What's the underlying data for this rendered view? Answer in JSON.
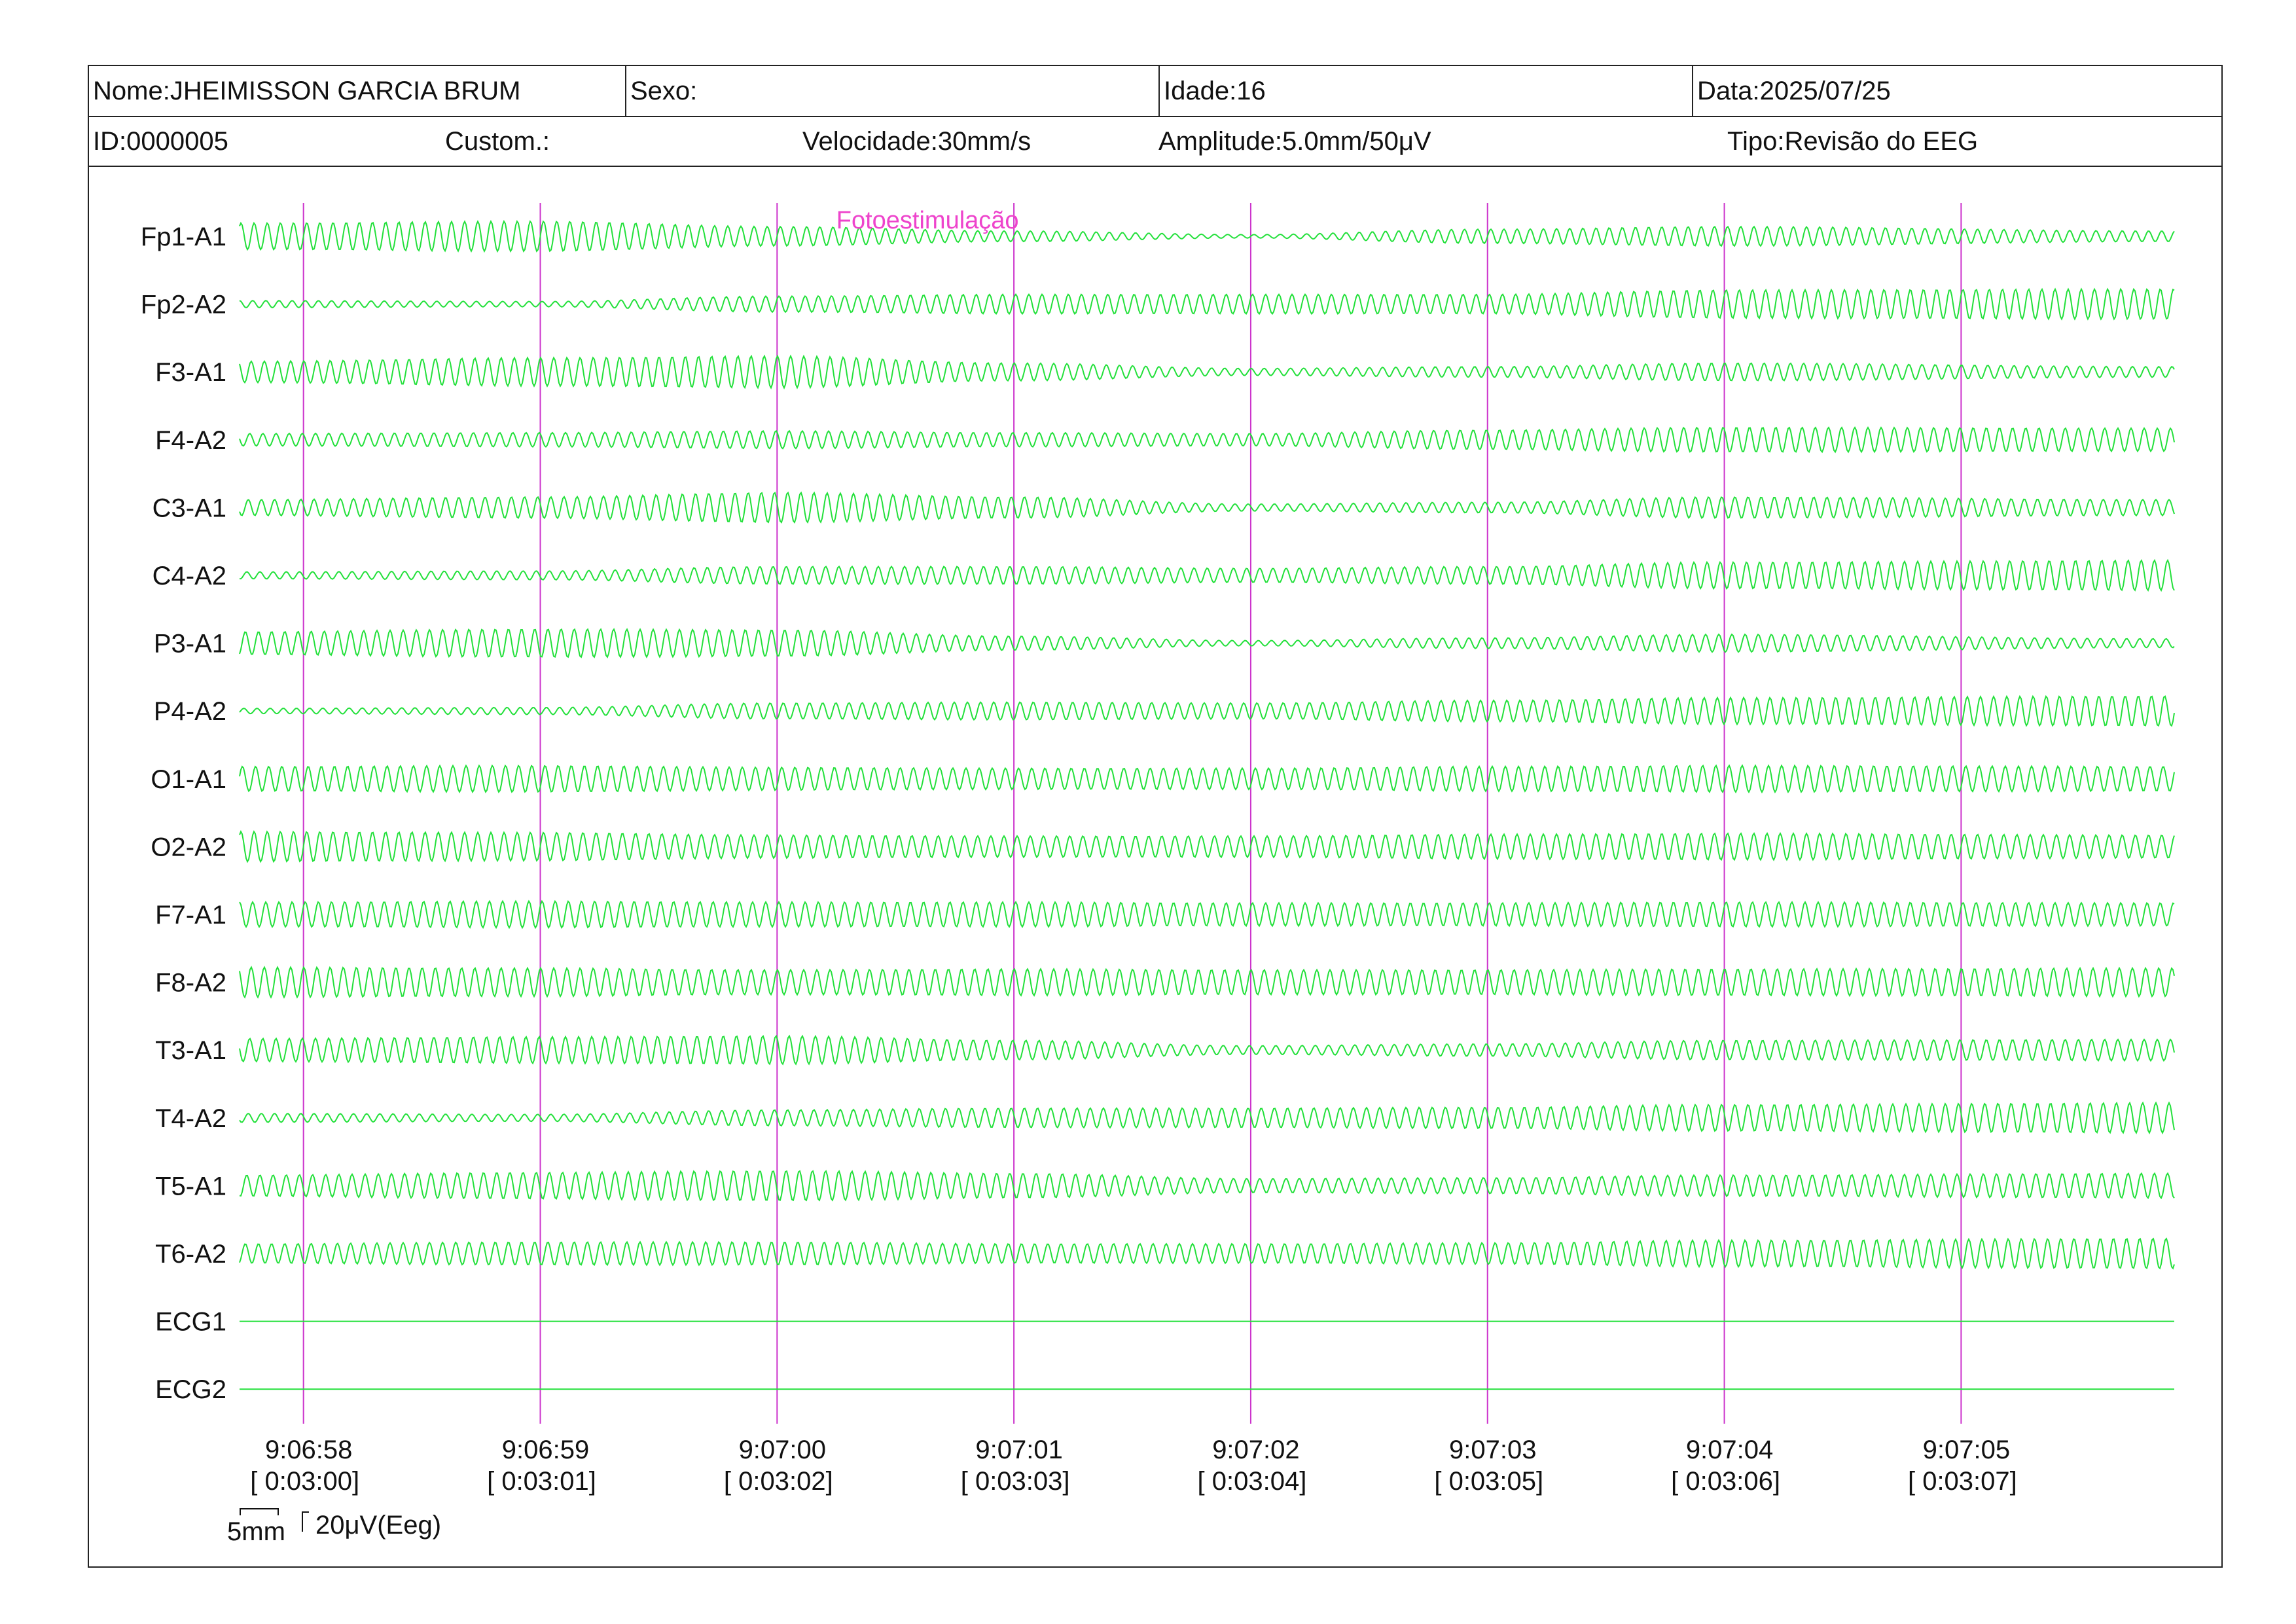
{
  "header": {
    "nome": "Nome:JHEIMISSON GARCIA BRUM",
    "sexo": "Sexo:",
    "idade": "Idade:16",
    "data": "Data:2025/07/25",
    "id": "ID:0000005",
    "custom": "Custom.:",
    "velocidade": "Velocidade:30mm/s",
    "amplitude": "Amplitude:5.0mm/50μV",
    "tipo": "Tipo:Revisão do EEG"
  },
  "colors": {
    "trace": "#22e03a",
    "marker": "#cc33cc",
    "annotation": "#ee44cc",
    "text": "#111111",
    "border": "#222222"
  },
  "chart_data": {
    "type": "line",
    "channels": [
      "Fp1-A1",
      "Fp2-A2",
      "F3-A1",
      "F4-A2",
      "C3-A1",
      "C4-A2",
      "P3-A1",
      "P4-A2",
      "O1-A1",
      "O2-A2",
      "F7-A1",
      "F8-A2",
      "T3-A1",
      "T4-A2",
      "T5-A1",
      "T6-A2",
      "ECG1",
      "ECG2"
    ],
    "time_range_seconds": [
      -0.27,
      7.9
    ],
    "seconds_per_display": 8.17,
    "time_markers": [
      {
        "clock": "9:06:58",
        "elapsed": "[ 0:03:00]",
        "t": 0
      },
      {
        "clock": "9:06:59",
        "elapsed": "[ 0:03:01]",
        "t": 1
      },
      {
        "clock": "9:07:00",
        "elapsed": "[ 0:03:02]",
        "t": 2
      },
      {
        "clock": "9:07:01",
        "elapsed": "[ 0:03:03]",
        "t": 3
      },
      {
        "clock": "9:07:02",
        "elapsed": "[ 0:03:04]",
        "t": 4
      },
      {
        "clock": "9:07:03",
        "elapsed": "[ 0:03:05]",
        "t": 5
      },
      {
        "clock": "9:07:04",
        "elapsed": "[ 0:03:06]",
        "t": 6
      },
      {
        "clock": "9:07:05",
        "elapsed": "[ 0:03:07]",
        "t": 7
      }
    ],
    "annotation": {
      "text": "Fotoestimulação",
      "t": 2.25
    },
    "oscillation_frequency_hz": 18,
    "amplitude_envelope_breakpoints_t": [
      -0.27,
      1.0,
      2.0,
      3.0,
      4.0,
      5.0,
      6.0,
      7.9
    ],
    "channel_amplitude_envelopes": [
      [
        0.75,
        0.85,
        0.55,
        0.3,
        0.1,
        0.4,
        0.55,
        0.3
      ],
      [
        0.2,
        0.15,
        0.45,
        0.55,
        0.55,
        0.55,
        0.8,
        0.85
      ],
      [
        0.6,
        0.8,
        0.9,
        0.5,
        0.2,
        0.3,
        0.5,
        0.3
      ],
      [
        0.35,
        0.4,
        0.5,
        0.4,
        0.35,
        0.55,
        0.7,
        0.65
      ],
      [
        0.45,
        0.6,
        0.85,
        0.6,
        0.2,
        0.3,
        0.6,
        0.45
      ],
      [
        0.2,
        0.25,
        0.5,
        0.5,
        0.4,
        0.5,
        0.75,
        0.85
      ],
      [
        0.65,
        0.8,
        0.75,
        0.4,
        0.15,
        0.3,
        0.5,
        0.25
      ],
      [
        0.15,
        0.2,
        0.45,
        0.5,
        0.45,
        0.6,
        0.75,
        0.85
      ],
      [
        0.7,
        0.75,
        0.65,
        0.6,
        0.6,
        0.7,
        0.75,
        0.7
      ],
      [
        0.85,
        0.8,
        0.65,
        0.6,
        0.6,
        0.7,
        0.75,
        0.65
      ],
      [
        0.7,
        0.75,
        0.7,
        0.7,
        0.65,
        0.65,
        0.7,
        0.65
      ],
      [
        0.85,
        0.8,
        0.7,
        0.75,
        0.7,
        0.7,
        0.75,
        0.8
      ],
      [
        0.65,
        0.75,
        0.8,
        0.55,
        0.25,
        0.35,
        0.55,
        0.6
      ],
      [
        0.25,
        0.2,
        0.45,
        0.55,
        0.55,
        0.6,
        0.75,
        0.85
      ],
      [
        0.6,
        0.75,
        0.85,
        0.7,
        0.4,
        0.45,
        0.6,
        0.7
      ],
      [
        0.55,
        0.65,
        0.65,
        0.55,
        0.55,
        0.6,
        0.75,
        0.85
      ],
      [
        0,
        0,
        0,
        0,
        0,
        0,
        0,
        0
      ],
      [
        0,
        0,
        0,
        0,
        0,
        0,
        0,
        0
      ]
    ],
    "scale_bar": {
      "time_label": "5mm",
      "amplitude_label": "20μV(Eeg)"
    }
  }
}
